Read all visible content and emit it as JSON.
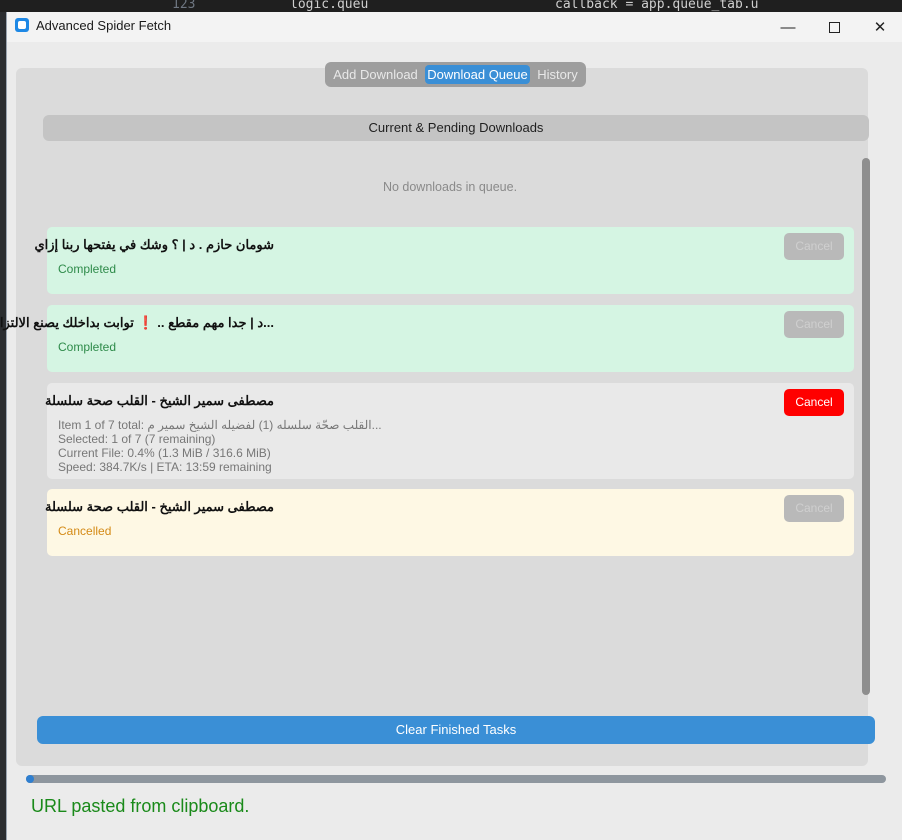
{
  "background": {
    "line_number": "123",
    "code_left": "logic.queu",
    "code_right": "callback = app.queue_tab.u"
  },
  "window": {
    "title": "Advanced Spider Fetch",
    "controls": {
      "minimize": "—",
      "close": "✕"
    }
  },
  "tabs": [
    {
      "label": "Add Download",
      "selected": false
    },
    {
      "label": "Download Queue",
      "selected": true
    },
    {
      "label": "History",
      "selected": false
    }
  ],
  "queue": {
    "header": "Current & Pending Downloads",
    "empty_message": "No downloads in queue.",
    "items": [
      {
        "title": "شومان حازم . د | ؟ وشك في يفتحها ربنا إزاي",
        "status": "Completed",
        "state": "completed",
        "cancel_label": "Cancel"
      },
      {
        "title": "...د | جدا مهم مقطع .. ❗ توابت بداخلك يصنع الالتزام",
        "status": "Completed",
        "state": "completed",
        "cancel_label": "Cancel"
      },
      {
        "title": "مصطفى سمير الشيخ - القلب صحة سلسلة",
        "state": "active",
        "cancel_label": "Cancel",
        "details": [
          "Item 1 of 7 total: القلب صحّة سلسله (1) لفضيله الشيخ سمير م...",
          "Selected: 1 of 7 (7 remaining)",
          "Current File: 0.4% (1.3 MiB / 316.6 MiB)",
          "Speed: 384.7K/s | ETA: 13:59 remaining"
        ]
      },
      {
        "title": "مصطفى سمير الشيخ - القلب صحة سلسلة",
        "status": "Cancelled",
        "state": "cancelled",
        "cancel_label": "Cancel"
      }
    ],
    "clear_button": "Clear Finished Tasks"
  },
  "overall_progress": 0.009,
  "status_message": "URL pasted from clipboard.",
  "colors": {
    "accent": "#3a8fd6",
    "completed_bg": "#d5f5e3",
    "cancelled_bg": "#fef8e4",
    "cancel_active": "#ff0000",
    "status_text": "#1a8a1a"
  }
}
